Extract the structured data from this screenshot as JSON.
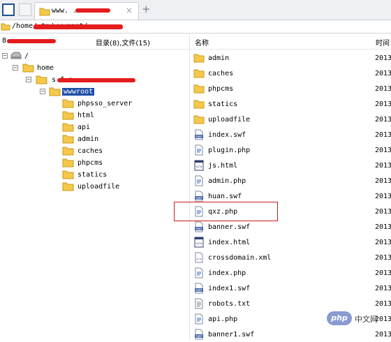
{
  "tab": {
    "title": "www.                  .com",
    "close": "×",
    "new": "+"
  },
  "path": {
    "text": "/home/                              tn/wwwroot/"
  },
  "left": {
    "header_count": "目录(8),文件(15)",
    "header_prefix": "8",
    "tree": [
      {
        "label": "/",
        "icon": "drive-icon",
        "expander": "−"
      },
      {
        "label": "home",
        "icon": "folder-icon",
        "expander": "−"
      },
      {
        "label": "s       f       n",
        "icon": "folder-icon",
        "expander": "−"
      },
      {
        "label": "wwwroot",
        "icon": "folder-icon",
        "expander": "−",
        "selected": true
      },
      {
        "label": "phpsso_server",
        "icon": "folder-icon"
      },
      {
        "label": "html",
        "icon": "folder-icon"
      },
      {
        "label": "api",
        "icon": "folder-icon"
      },
      {
        "label": "admin",
        "icon": "folder-icon"
      },
      {
        "label": "caches",
        "icon": "folder-icon"
      },
      {
        "label": "phpcms",
        "icon": "folder-icon"
      },
      {
        "label": "statics",
        "icon": "folder-icon"
      },
      {
        "label": "uploadfile",
        "icon": "folder-icon"
      }
    ]
  },
  "right": {
    "col_name": "名称",
    "col_time": "时间",
    "files": [
      {
        "name": "admin",
        "icon": "folder-icon",
        "year": "2013"
      },
      {
        "name": "caches",
        "icon": "folder-icon",
        "year": "2013"
      },
      {
        "name": "phpcms",
        "icon": "folder-icon",
        "year": "2013"
      },
      {
        "name": "statics",
        "icon": "folder-icon",
        "year": "2013"
      },
      {
        "name": "uploadfile",
        "icon": "folder-icon",
        "year": "2013"
      },
      {
        "name": "index.swf",
        "icon": "swf-icon",
        "year": "2013"
      },
      {
        "name": "plugin.php",
        "icon": "php-icon",
        "year": "2013"
      },
      {
        "name": "js.html",
        "icon": "html-icon",
        "year": "2013"
      },
      {
        "name": "admin.php",
        "icon": "php-icon",
        "year": "2013"
      },
      {
        "name": "huan.swf",
        "icon": "swf-icon",
        "year": "2013"
      },
      {
        "name": "qxz.php",
        "icon": "php-icon",
        "year": "2013",
        "highlighted": true
      },
      {
        "name": "banner.swf",
        "icon": "swf-icon",
        "year": "2013"
      },
      {
        "name": "index.html",
        "icon": "html-icon",
        "year": "2013"
      },
      {
        "name": "crossdomain.xml",
        "icon": "xml-icon",
        "year": "2013"
      },
      {
        "name": "index.php",
        "icon": "php-icon",
        "year": "2013"
      },
      {
        "name": "index1.swf",
        "icon": "swf-icon",
        "year": "2013"
      },
      {
        "name": "robots.txt",
        "icon": "txt-icon",
        "year": "2013"
      },
      {
        "name": "api.php",
        "icon": "php-icon",
        "year": "2013"
      },
      {
        "name": "banner1.swf",
        "icon": "swf-icon",
        "year": "2013"
      }
    ]
  },
  "watermark": {
    "logo": "php",
    "text": "中文网"
  },
  "colors": {
    "folder": "#f6c84a",
    "selection": "#1e4fa4",
    "redaction": "#e41c1c",
    "highlight_border": "#d01818"
  }
}
